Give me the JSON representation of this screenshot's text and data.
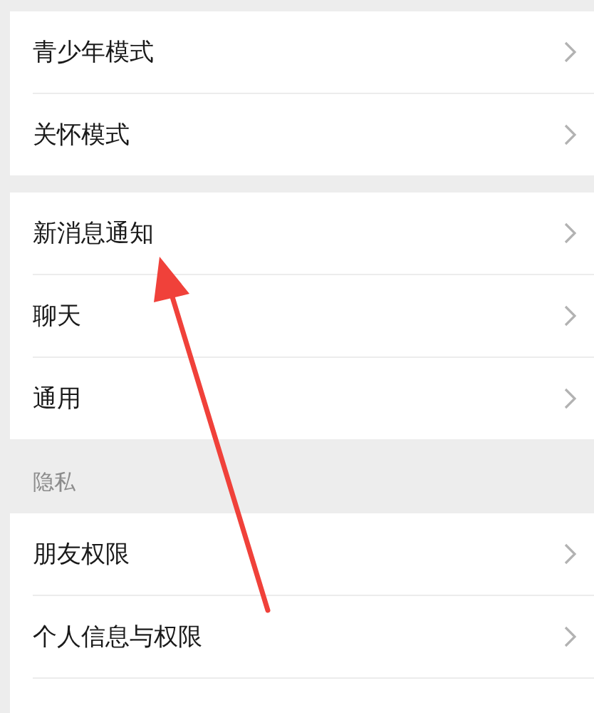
{
  "groups": [
    {
      "items": [
        {
          "label": "青少年模式"
        },
        {
          "label": "关怀模式"
        }
      ]
    },
    {
      "items": [
        {
          "label": "新消息通知"
        },
        {
          "label": "聊天"
        },
        {
          "label": "通用"
        }
      ]
    },
    {
      "header": "隐私",
      "items": [
        {
          "label": "朋友权限"
        },
        {
          "label": "个人信息与权限"
        }
      ]
    }
  ]
}
